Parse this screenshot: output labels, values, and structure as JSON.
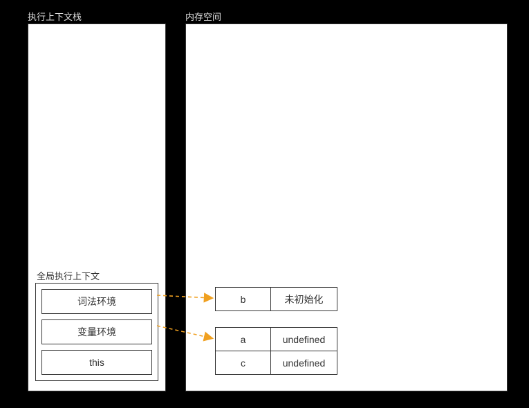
{
  "stack": {
    "title": "执行上下文栈",
    "global_context_title": "全局执行上下文",
    "envs": {
      "lexical": "词法环境",
      "variable": "变量环境",
      "this": "this"
    }
  },
  "memory": {
    "title": "内存空间",
    "lexical_table": [
      {
        "name": "b",
        "value": "未初始化"
      }
    ],
    "variable_table": [
      {
        "name": "a",
        "value": "undefined"
      },
      {
        "name": "c",
        "value": "undefined"
      }
    ]
  },
  "colors": {
    "arrow": "#f0a020"
  }
}
